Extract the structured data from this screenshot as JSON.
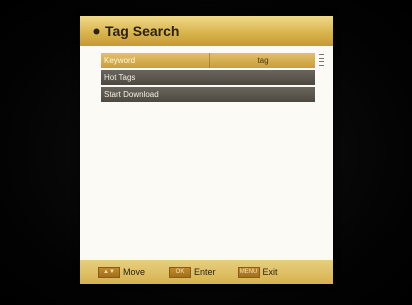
{
  "dialog": {
    "title": "Tag Search"
  },
  "menu": {
    "items": [
      {
        "label": "Keyword",
        "value": "tag",
        "selected": true
      },
      {
        "label": "Hot Tags",
        "selected": false
      },
      {
        "label": "Start Download",
        "selected": false
      }
    ]
  },
  "footer": {
    "hints": [
      {
        "key": "▲▼",
        "label": "Move"
      },
      {
        "key": "OK",
        "label": "Enter"
      },
      {
        "key": "MENU",
        "label": "Exit"
      }
    ]
  },
  "colors": {
    "accent_gold": "#d9b54e",
    "row_dark": "#5a564d",
    "panel_bg": "#fbfaf5"
  }
}
